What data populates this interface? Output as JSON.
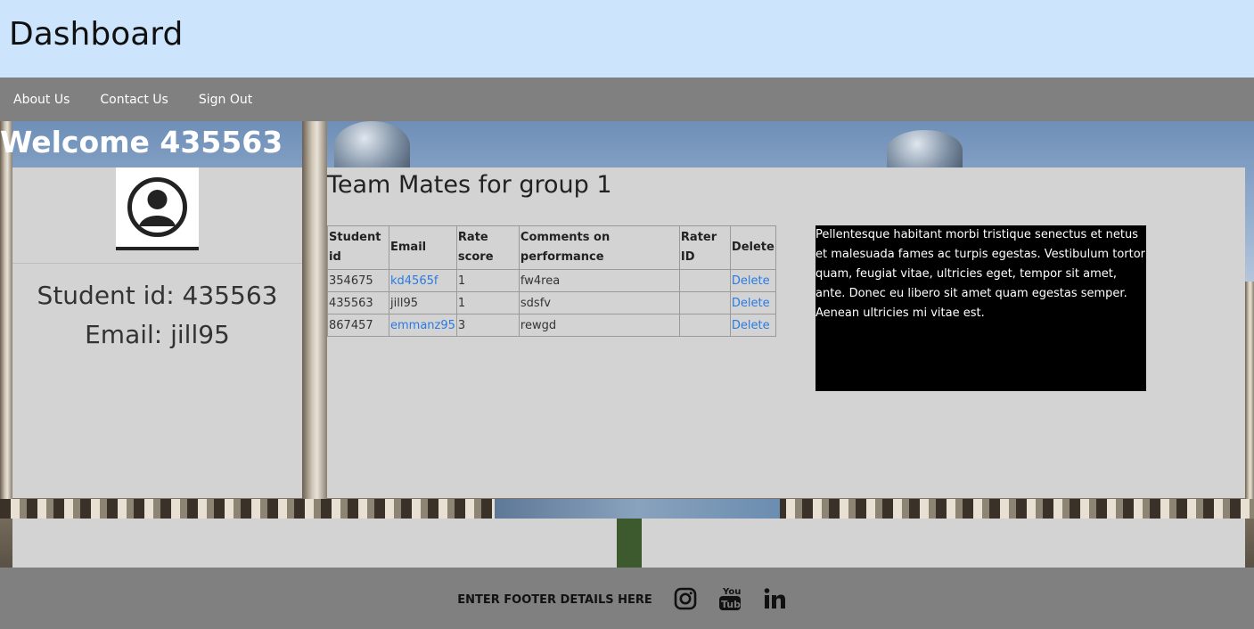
{
  "header": {
    "title": "Dashboard"
  },
  "nav": {
    "items": [
      "About Us",
      "Contact Us",
      "Sign Out"
    ]
  },
  "welcome": "Welcome 435563",
  "profile": {
    "student_id_line": "Student id: 435563",
    "email_line": "Email: jill95"
  },
  "team": {
    "heading": "Team Mates for group 1",
    "columns": [
      "Student id",
      "Email",
      "Rate score",
      "Comments on performance",
      "Rater ID",
      "Delete"
    ],
    "rows": [
      {
        "student_id": "354675",
        "email": "kd4565f",
        "email_link": true,
        "rate": "1",
        "comment": "fw4rea",
        "rater": "",
        "delete": "Delete"
      },
      {
        "student_id": "435563",
        "email": "jill95",
        "email_link": false,
        "rate": "1",
        "comment": "sdsfv",
        "rater": "",
        "delete": "Delete"
      },
      {
        "student_id": "867457",
        "email": "emmanz95",
        "email_link": true,
        "rate": "3",
        "comment": "rewgd",
        "rater": "",
        "delete": "Delete"
      }
    ]
  },
  "info_box": {
    "text": "Pellentesque habitant morbi tristique senectus et netus et malesuada fames ac turpis egestas. Vestibulum tortor quam, feugiat vitae, ultricies eget, tempor sit amet, ante. Donec eu libero sit amet quam egestas semper. Aenean ultricies mi vitae est."
  },
  "footer": {
    "text": "ENTER FOOTER DETAILS HERE",
    "icons": [
      "instagram-icon",
      "youtube-icon",
      "linkedin-icon"
    ]
  },
  "colors": {
    "header_bg": "#cce4fc",
    "nav_bg": "#808080",
    "panel_bg": "#d3d3d3",
    "link": "#2a7ae2"
  }
}
